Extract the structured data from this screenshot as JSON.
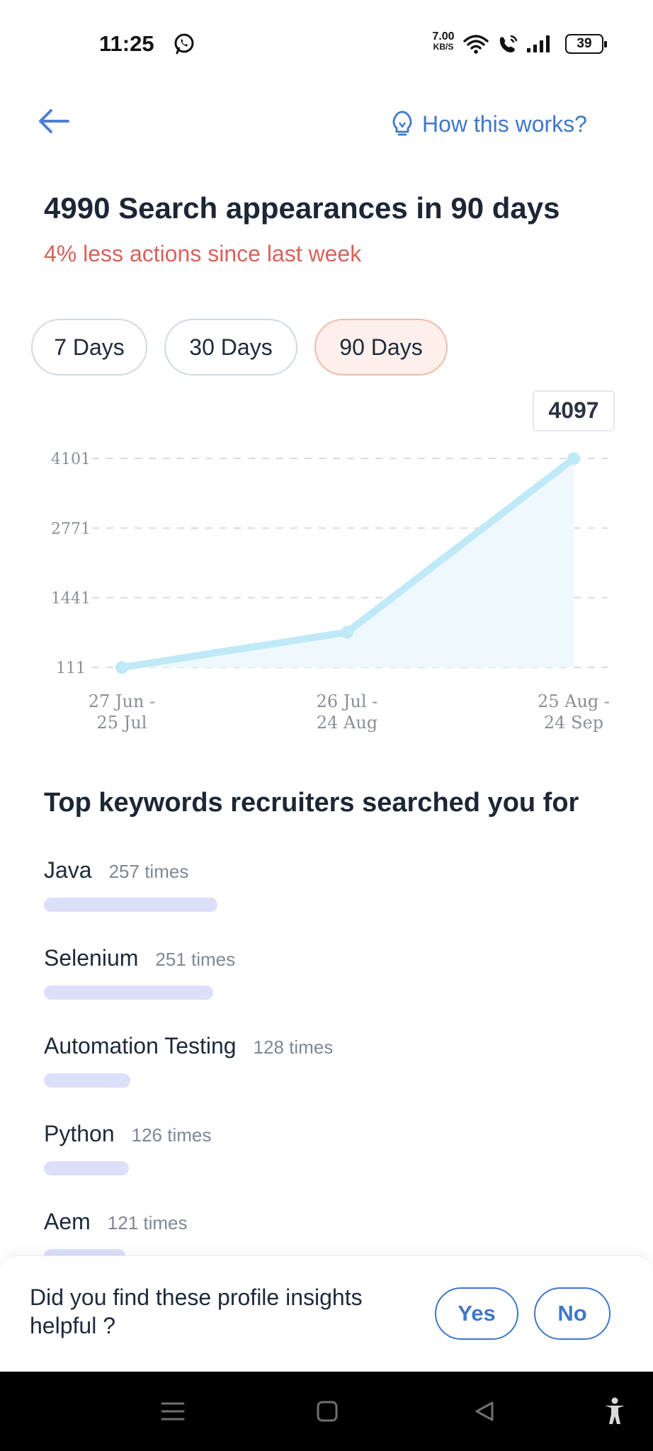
{
  "status_bar": {
    "time": "11:25",
    "net_speed": "7.00",
    "net_speed_unit": "KB/S",
    "battery": "39"
  },
  "header": {
    "back_icon": "arrow-left-icon",
    "how_label": "How this works?",
    "how_icon": "lightbulb-icon"
  },
  "summary": {
    "title": "4990 Search appearances in 90 days",
    "subtitle": "4% less actions since last week"
  },
  "periods": [
    {
      "label": "7 Days",
      "selected": false
    },
    {
      "label": "30 Days",
      "selected": false
    },
    {
      "label": "90 Days",
      "selected": true
    }
  ],
  "chart_data": {
    "type": "area",
    "categories": [
      "27 Jun - 25 Jul",
      "26 Jul - 24 Aug",
      "25 Aug - 24 Sep"
    ],
    "category_lines": [
      [
        "27 Jun -",
        "25 Jul"
      ],
      [
        "26 Jul -",
        "24 Aug"
      ],
      [
        "25 Aug -",
        "24 Sep"
      ]
    ],
    "values": [
      111,
      782,
      4097
    ],
    "y_ticks": [
      111,
      1441,
      2771,
      4101
    ],
    "ylim": [
      111,
      4101
    ],
    "grid": true,
    "highlight_label": "4097",
    "line_color": "#bfe9f7",
    "fill_color": "#eef8fd"
  },
  "keywords": {
    "title": "Top keywords recruiters searched you for",
    "items": [
      {
        "name": "Java",
        "count": "257 times",
        "value": 257
      },
      {
        "name": "Selenium",
        "count": "251 times",
        "value": 251
      },
      {
        "name": "Automation Testing",
        "count": "128 times",
        "value": 128
      },
      {
        "name": "Python",
        "count": "126 times",
        "value": 126
      },
      {
        "name": "Aem",
        "count": "121 times",
        "value": 121
      }
    ],
    "bar_color": "#dcdff8"
  },
  "feedback": {
    "question": "Did you find these profile insights helpful ?",
    "yes_label": "Yes",
    "no_label": "No"
  },
  "nav_bar": {
    "icons": [
      "menu-icon",
      "home-square-icon",
      "back-triangle-icon",
      "accessibility-icon"
    ]
  }
}
